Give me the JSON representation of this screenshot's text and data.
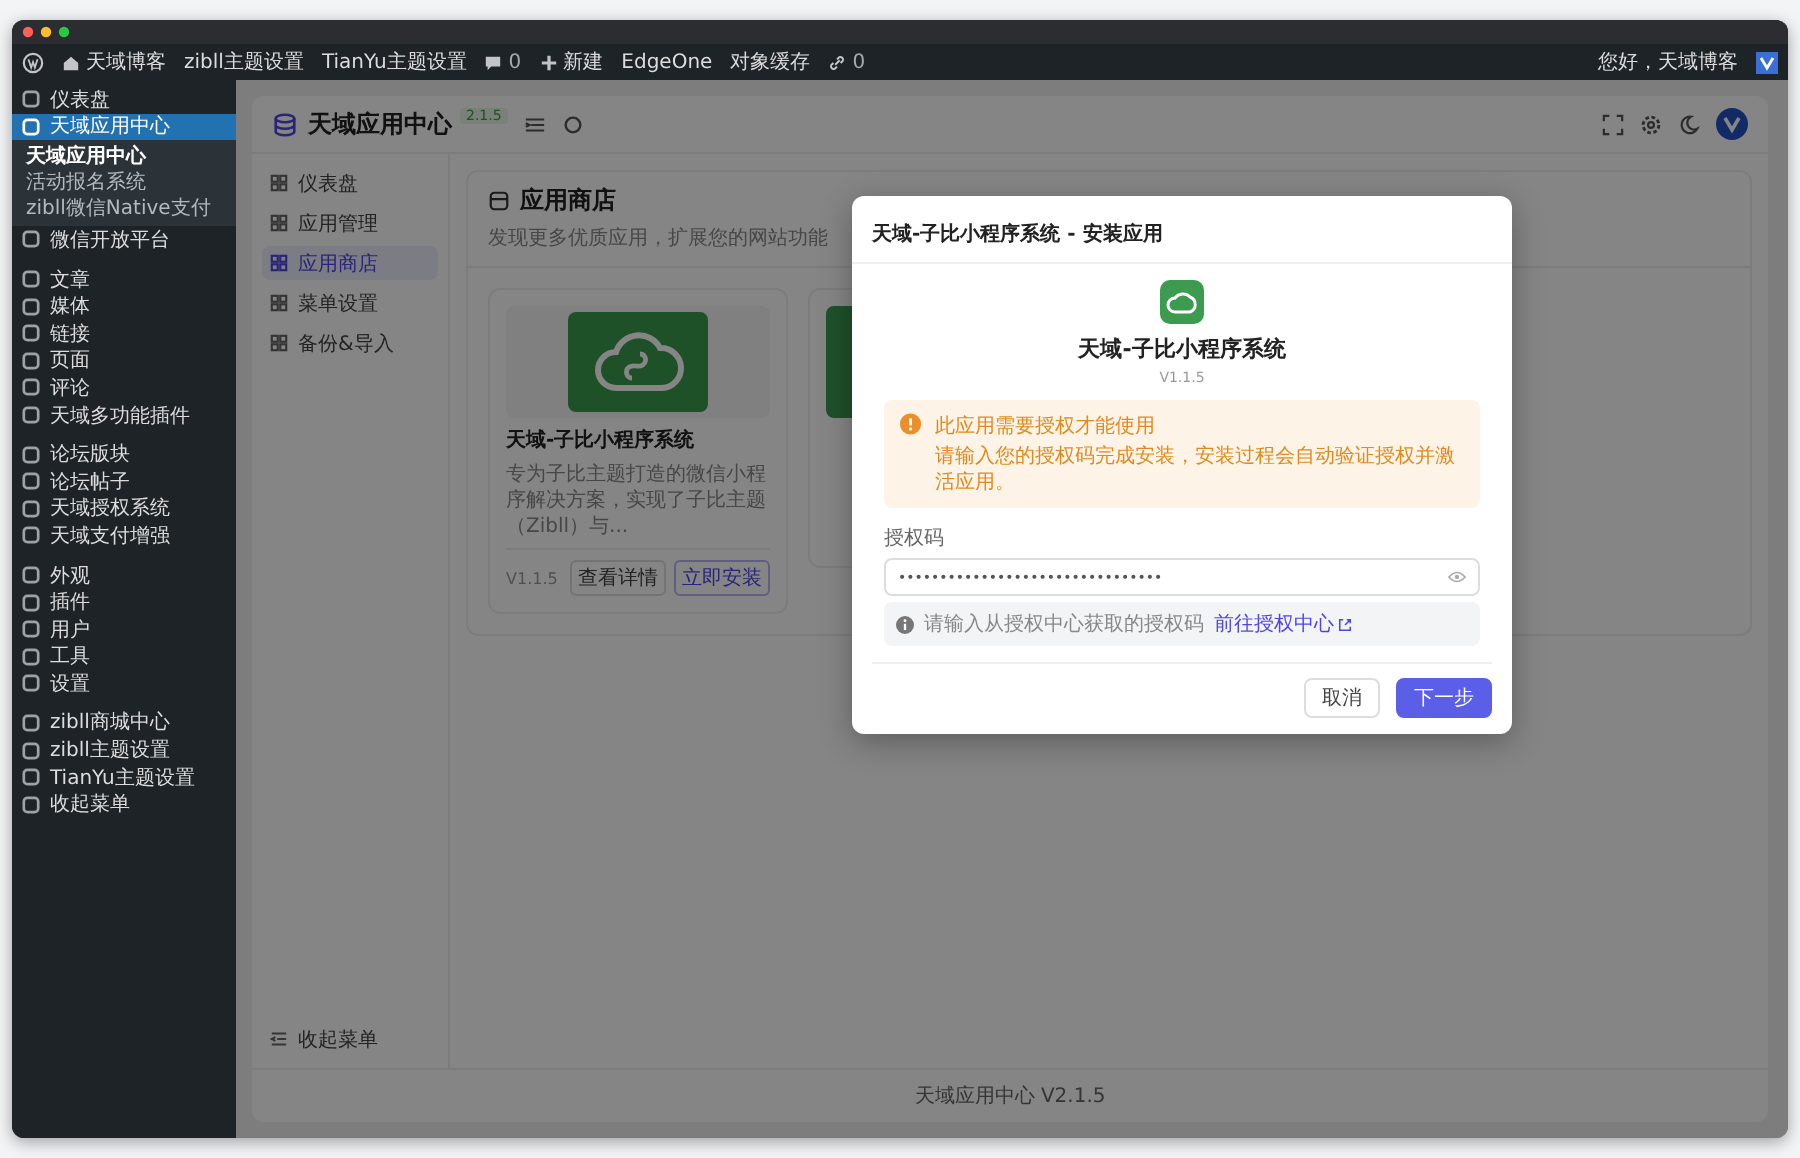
{
  "admin_bar": {
    "items": [
      {
        "kind": "site",
        "label": "天域博客"
      },
      {
        "kind": "text",
        "label": "zibll主题设置"
      },
      {
        "kind": "text",
        "label": "TianYu主题设置"
      },
      {
        "kind": "comments",
        "label": "0"
      },
      {
        "kind": "new",
        "label": "新建"
      },
      {
        "kind": "text",
        "label": "EdgeOne"
      },
      {
        "kind": "text",
        "label": "对象缓存"
      },
      {
        "kind": "links",
        "label": "0"
      }
    ],
    "greeting": "您好，天域博客"
  },
  "sidebar": {
    "groups": [
      [
        {
          "label": "仪表盘",
          "selected": false
        },
        {
          "label": "天域应用中心",
          "selected": true,
          "submenu": [
            {
              "label": "天域应用中心",
              "selected": true
            },
            {
              "label": "活动报名系统",
              "selected": false
            },
            {
              "label": "zibll微信Native支付",
              "selected": false
            }
          ]
        },
        {
          "label": "微信开放平台",
          "selected": false
        }
      ],
      [
        {
          "label": "文章",
          "selected": false
        },
        {
          "label": "媒体",
          "selected": false
        },
        {
          "label": "链接",
          "selected": false
        },
        {
          "label": "页面",
          "selected": false
        },
        {
          "label": "评论",
          "selected": false
        },
        {
          "label": "天域多功能插件",
          "selected": false
        }
      ],
      [
        {
          "label": "论坛版块",
          "selected": false
        },
        {
          "label": "论坛帖子",
          "selected": false
        },
        {
          "label": "天域授权系统",
          "selected": false
        },
        {
          "label": "天域支付增强",
          "selected": false
        }
      ],
      [
        {
          "label": "外观",
          "selected": false
        },
        {
          "label": "插件",
          "selected": false
        },
        {
          "label": "用户",
          "selected": false
        },
        {
          "label": "工具",
          "selected": false
        },
        {
          "label": "设置",
          "selected": false
        }
      ],
      [
        {
          "label": "zibll商城中心",
          "selected": false
        },
        {
          "label": "zibll主题设置",
          "selected": false
        },
        {
          "label": "TianYu主题设置",
          "selected": false
        },
        {
          "label": "收起菜单",
          "selected": false
        }
      ]
    ]
  },
  "app": {
    "title": "天域应用中心",
    "version_badge": "2.1.5",
    "nav": [
      {
        "label": "仪表盘",
        "selected": false
      },
      {
        "label": "应用管理",
        "selected": false
      },
      {
        "label": "应用商店",
        "selected": true
      },
      {
        "label": "菜单设置",
        "selected": false
      },
      {
        "label": "备份&导入",
        "selected": false
      }
    ],
    "collapse": "收起菜单",
    "footer": "天域应用中心 V2.1.5"
  },
  "store": {
    "title": "应用商店",
    "subtitle": "发现更多优质应用，扩展您的网站功能",
    "apps": [
      {
        "name": "天域-子比小程序系统",
        "description": "专为子比主题打造的微信小程序解决方案，实现了子比主题（Zibll）与...",
        "version": "V1.1.5",
        "details": "查看详情",
        "install": "立即安装"
      }
    ]
  },
  "modal": {
    "title": "天域-子比小程序系统 - 安装应用",
    "app_name": "天域-子比小程序系统",
    "version": "V1.1.5",
    "alert": {
      "title": "此应用需要授权才能使用",
      "text": "请输入您的授权码完成安装，安装过程会自动验证授权并激活应用。"
    },
    "field_label": "授权码",
    "value": "••••••••••••••••••••••••••••••••",
    "hint": "请输入从授权中心获取的授权码",
    "link": "前往授权中心",
    "buttons": {
      "cancel": "取消",
      "next": "下一步"
    }
  }
}
